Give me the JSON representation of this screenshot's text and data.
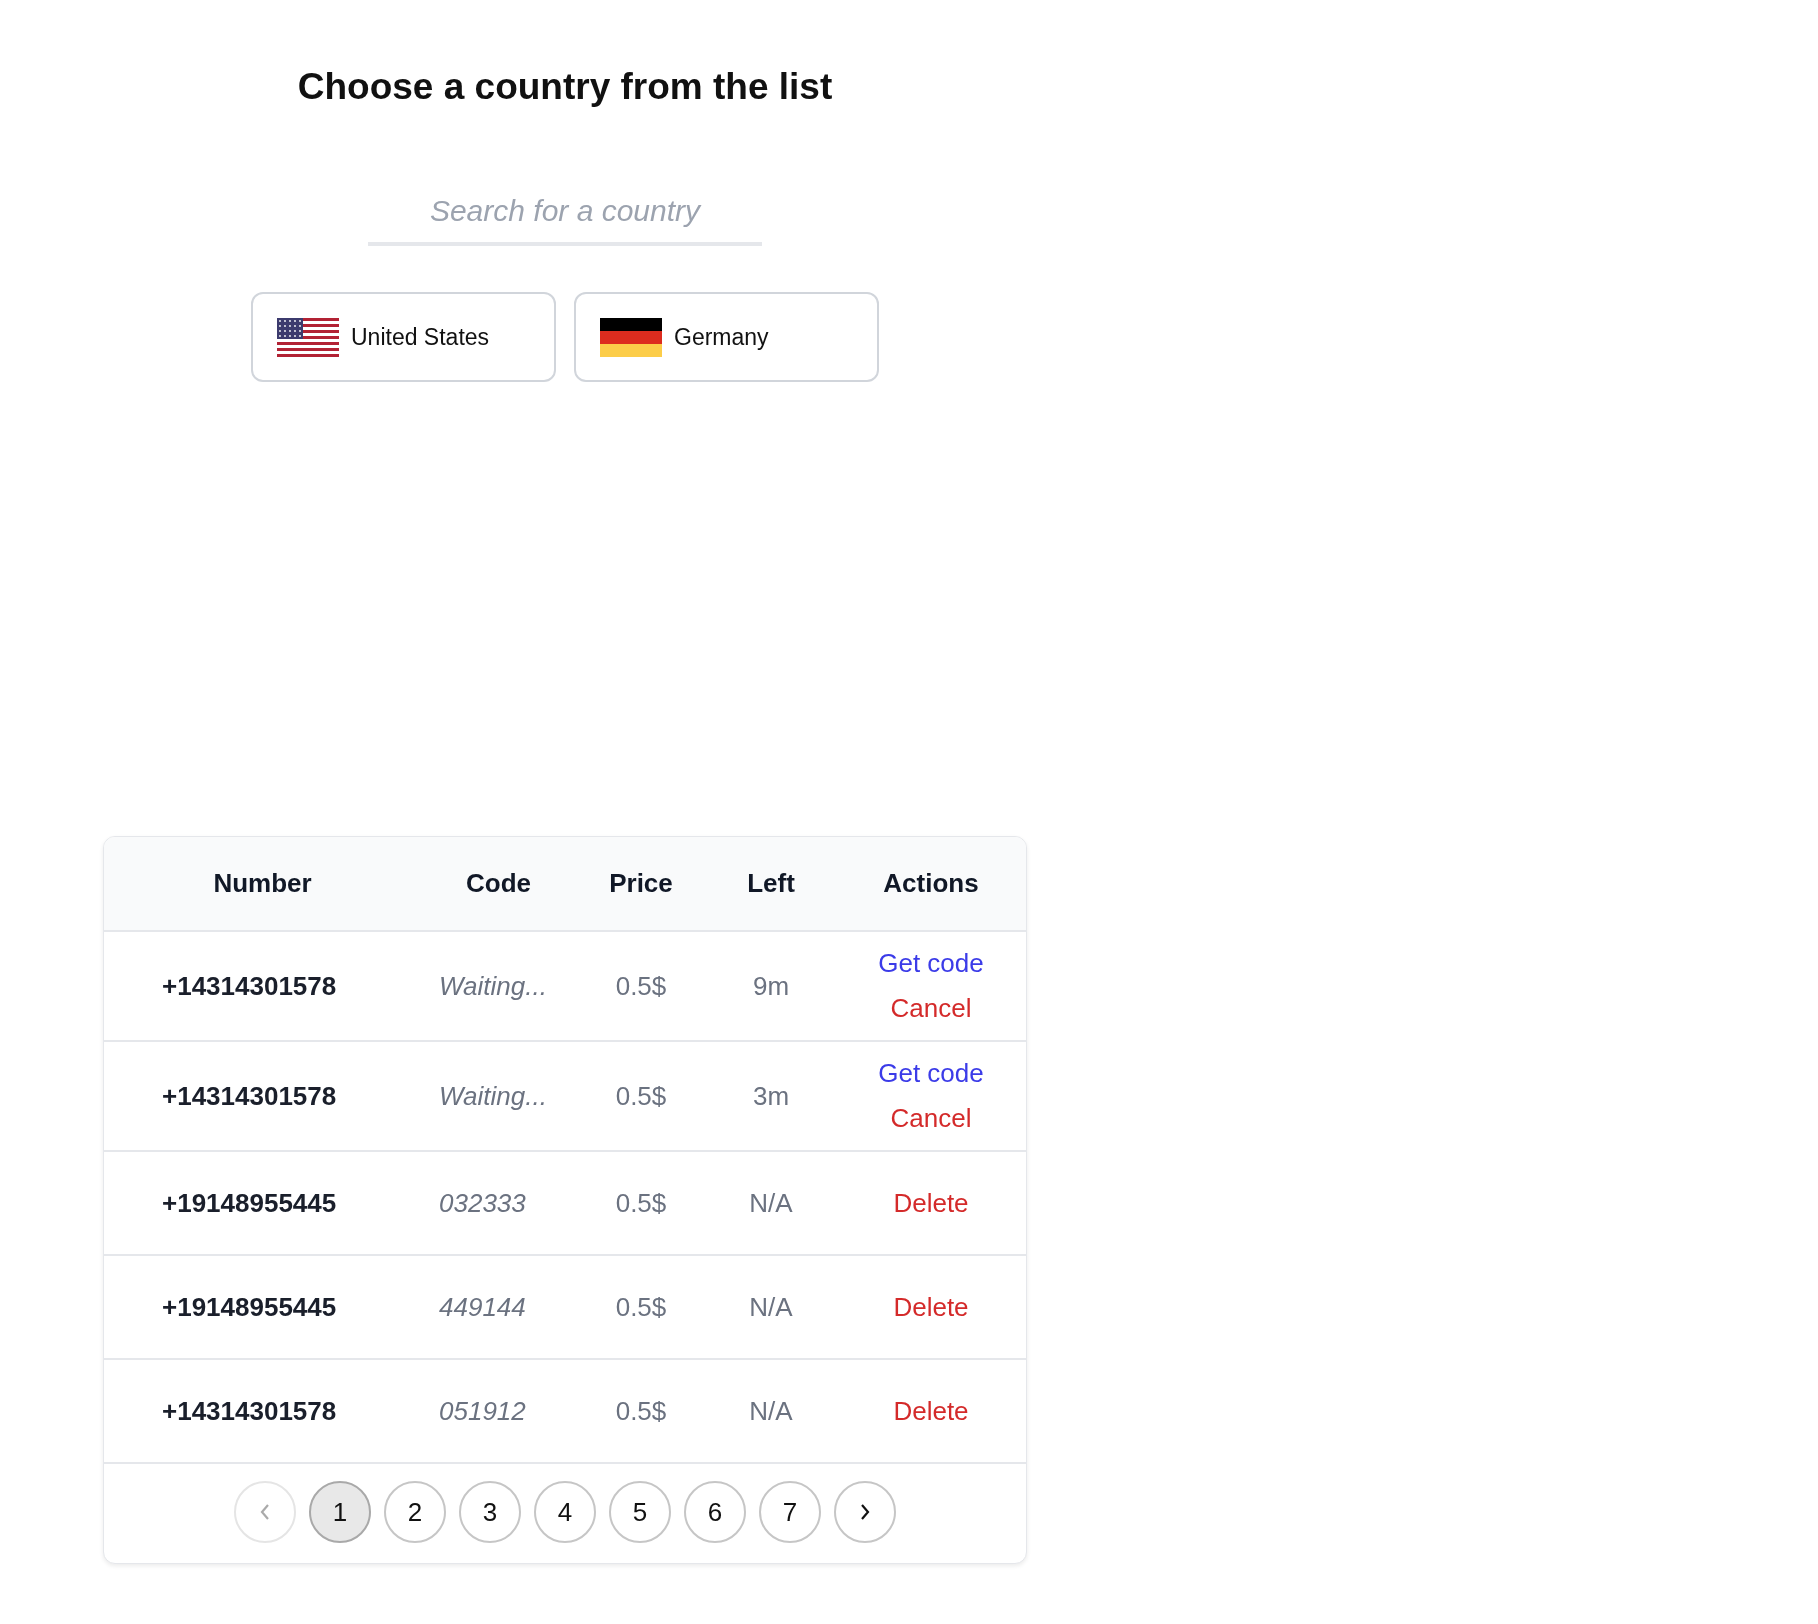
{
  "title": "Choose a country from the list",
  "search": {
    "placeholder": "Search for a country"
  },
  "countries": [
    {
      "name": "United States",
      "kind": "us_flag"
    },
    {
      "name": "Germany",
      "kind": "de_flag"
    }
  ],
  "table": {
    "columns": [
      "Number",
      "Code",
      "Price",
      "Left",
      "Actions"
    ],
    "rows": [
      {
        "number": "+14314301578",
        "code": "Waiting...",
        "price": "0.5$",
        "left": "9m",
        "actions": [
          {
            "label": "Get code",
            "kind": "get_code"
          },
          {
            "label": "Cancel",
            "kind": "cancel"
          }
        ]
      },
      {
        "number": "+14314301578",
        "code": "Waiting...",
        "price": "0.5$",
        "left": "3m",
        "actions": [
          {
            "label": "Get code",
            "kind": "get_code"
          },
          {
            "label": "Cancel",
            "kind": "cancel"
          }
        ]
      },
      {
        "number": "+19148955445",
        "code": "032333",
        "price": "0.5$",
        "left": "N/A",
        "actions": [
          {
            "label": "Delete",
            "kind": "delete"
          }
        ]
      },
      {
        "number": "+19148955445",
        "code": "449144",
        "price": "0.5$",
        "left": "N/A",
        "actions": [
          {
            "label": "Delete",
            "kind": "delete"
          }
        ]
      },
      {
        "number": "+14314301578",
        "code": "051912",
        "price": "0.5$",
        "left": "N/A",
        "actions": [
          {
            "label": "Delete",
            "kind": "delete"
          }
        ]
      }
    ]
  },
  "pagination": {
    "prev": {
      "disabled": true
    },
    "pages": [
      {
        "label": "1",
        "selected": true
      },
      {
        "label": "2",
        "selected": false
      },
      {
        "label": "3",
        "selected": false
      },
      {
        "label": "4",
        "selected": false
      },
      {
        "label": "5",
        "selected": false
      },
      {
        "label": "6",
        "selected": false
      },
      {
        "label": "7",
        "selected": false
      }
    ],
    "next": {
      "disabled": false
    }
  }
}
